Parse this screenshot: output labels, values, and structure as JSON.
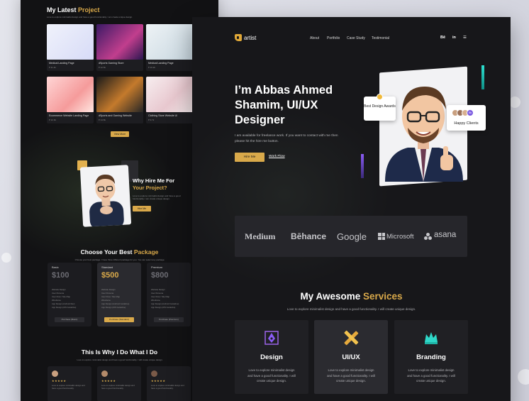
{
  "colors": {
    "accent": "#d9a94a",
    "bg": "#17171a",
    "teal": "#2de0d0",
    "purple": "#8b5cf6"
  },
  "left": {
    "projects": {
      "title_prefix": "My Latest",
      "title_accent": "Project",
      "subtitle": "Love to explore minimalist design and have a good functionality. I am create unique design.",
      "items": [
        {
          "title": "Medical Landing Page",
          "meta": "♥ 11.4k"
        },
        {
          "title": "dSports Gaming Store",
          "meta": "♥ 12.5k"
        },
        {
          "title": "Medical Landing Page",
          "meta": "♥ 10.2k"
        },
        {
          "title": "Ecommerce Website Landing Page",
          "meta": "♥ 12.3k"
        },
        {
          "title": "dSports and Gaming Website",
          "meta": "♥ 14.8k"
        },
        {
          "title": "Clothing Store Website UI",
          "meta": "♥ 9.7k"
        }
      ],
      "button": "View More"
    },
    "why": {
      "title_prefix": "Why Hire Me For",
      "title_accent": "Your Project?",
      "text": "Love to explore minimalist design and have a good functionality. I am create unique design.",
      "button": "Hire Me"
    },
    "packages": {
      "title_prefix": "Choose Your Best",
      "title_accent": "Package",
      "subtitle": "Choose your best package. I have three different package for you. You can select any package.",
      "items": [
        {
          "name": "Basic",
          "price": "$100",
          "features": [
            "Website Design",
            "User Persona",
            "User Flow / Site Map",
            "Wireframe",
            "App Design (Android Dev)",
            "App Design (iOS Guideline)"
          ],
          "button": "Purchase (Basic)"
        },
        {
          "name": "Standard",
          "price": "$500",
          "features": [
            "Website Design",
            "User Persona",
            "User Flow / Site Map",
            "Wireframe",
            "App Design (Android Guideline)",
            "App Design (iOS Guideline)"
          ],
          "button": "Purchase (Standard)"
        },
        {
          "name": "Premium",
          "price": "$800",
          "features": [
            "Website Design",
            "User Persona",
            "User Flow / Site Map",
            "Wireframe",
            "App Design (Android Guideline)",
            "App Design (iOS Guideline)"
          ],
          "button": "Purchase (Premium)"
        }
      ]
    },
    "testimonials": {
      "title": "This Is Why I Do What I Do",
      "subtitle": "Love to explore minimalist design and have a good functionality. I will create unique design.",
      "items": [
        {
          "stars": "★★★★★",
          "text": "Love to explore minimalist design and have a good functionality."
        },
        {
          "stars": "★★★★★",
          "text": "Love to explore minimalist design and have a good functionality."
        },
        {
          "stars": "★★★★★",
          "text": "Love to explore minimalist design and have a good functionality."
        }
      ]
    }
  },
  "right": {
    "logo": "artist",
    "nav": [
      "About",
      "Portfolio",
      "Case Study",
      "Testimonial"
    ],
    "social": [
      "Bē",
      "in",
      "☰"
    ],
    "hero": {
      "title": "I’m Abbas Ahmed Shamim, UI/UX Designer",
      "subtitle": "I am available for freelance work. If you want to contact with me then please hit the hire me button.",
      "hire_button": "Hire Me",
      "workflow_link": "Work Flow",
      "badge_award": "Best Design Awards",
      "badge_clients": "Happy Clients",
      "clients_count": "5k"
    },
    "brands": [
      "Medium",
      "Bēhance",
      "Google",
      "Microsoft",
      "asana"
    ],
    "services": {
      "title_prefix": "My Awesome",
      "title_accent": "Services",
      "subtitle": "Love to explore minimalist design and have a good functionality. I will create unique design.",
      "items": [
        {
          "name": "Design",
          "desc": "Love to explore minimalist design and have a good functionality. I will create unique design.",
          "icon": "pen-tool-icon"
        },
        {
          "name": "UI/UX",
          "desc": "Love to explore minimalist design and have a good functionality. I will create unique design.",
          "icon": "pencil-ruler-icon"
        },
        {
          "name": "Branding",
          "desc": "Love to explore minimalist design and have a good functionality. I will create unique design.",
          "icon": "crown-icon"
        }
      ]
    }
  }
}
